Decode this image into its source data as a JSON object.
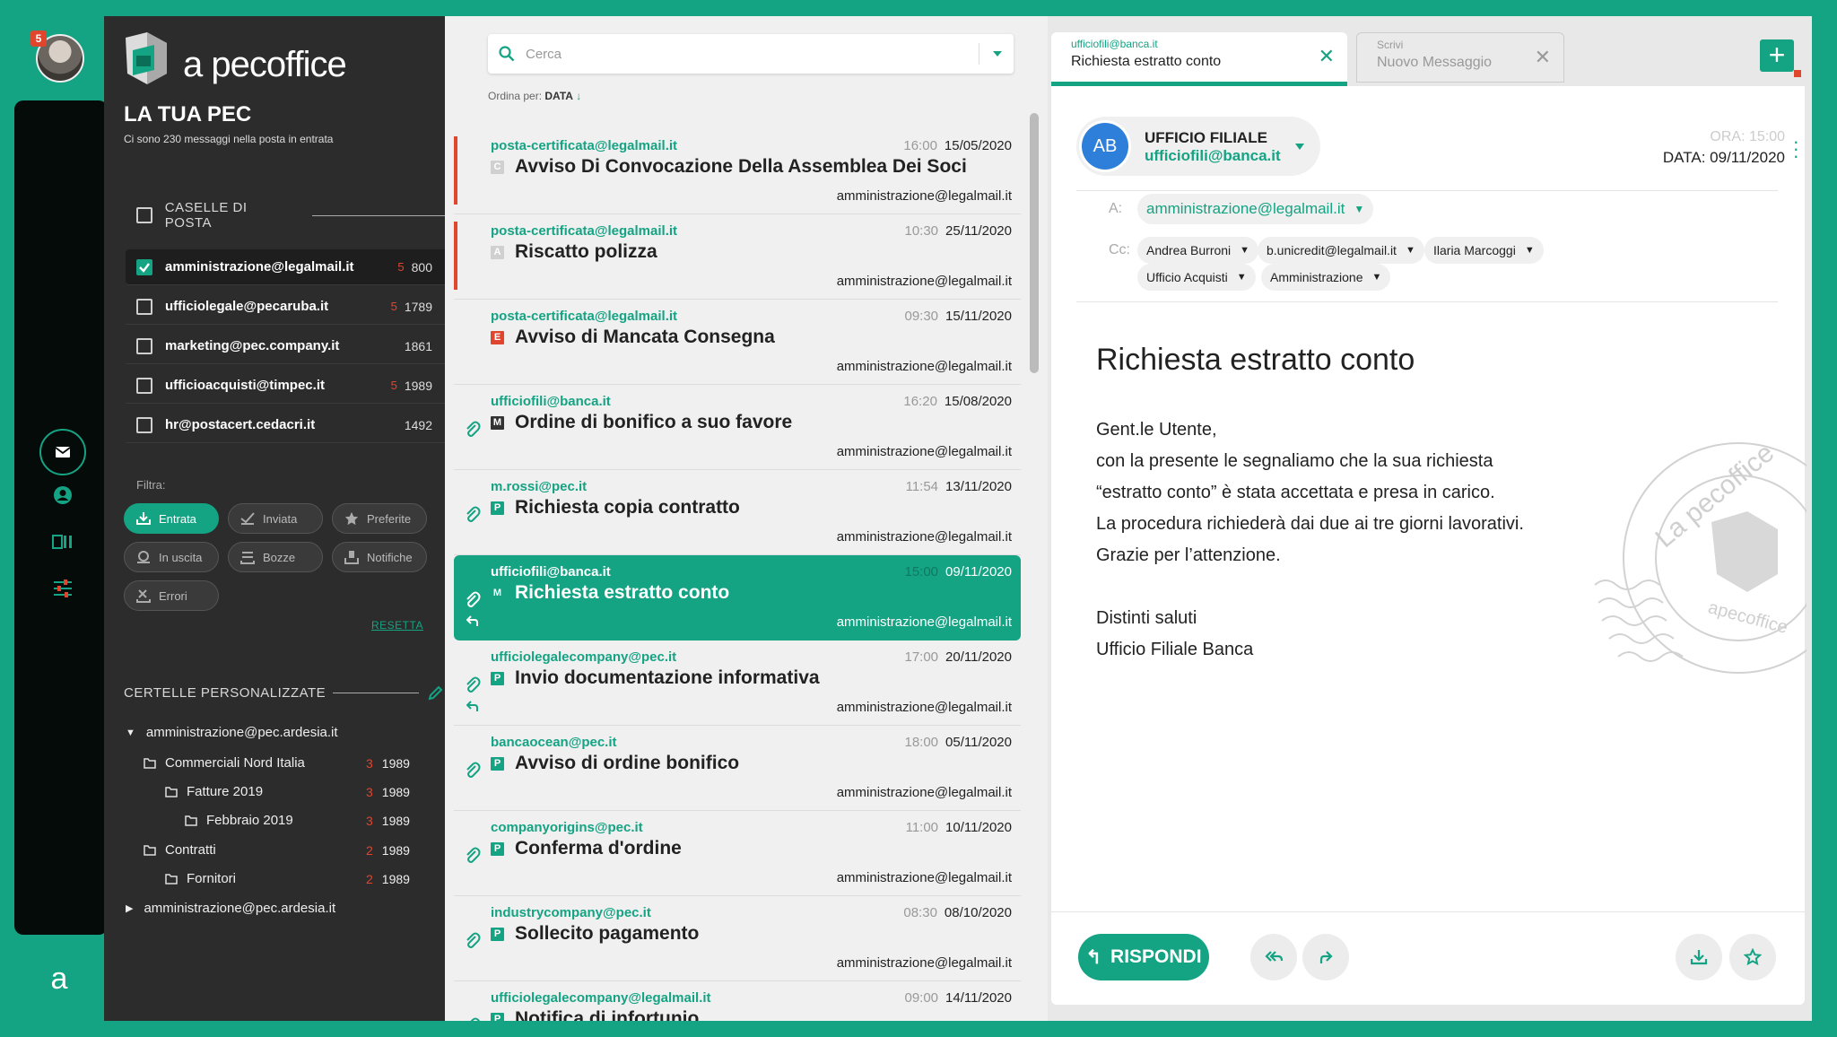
{
  "colors": {
    "brand": "#14a383",
    "alert": "#e0452e",
    "dark": "#2c2c2c"
  },
  "rail": {
    "notification_count": "5",
    "icons": [
      "mail-icon",
      "user-icon",
      "contacts-icon",
      "settings-sliders-icon"
    ],
    "bottom_logo": "a"
  },
  "sidebar": {
    "logo_text": "a pecoffice",
    "title": "LA TUA PEC",
    "subtitle": "Ci sono 230 messaggi nella posta in entrata",
    "mailboxes_header": "CASELLE DI POSTA",
    "mailboxes": [
      {
        "name": "amministrazione@legalmail.it",
        "unread": "5",
        "count": "800",
        "checked": true
      },
      {
        "name": "ufficiolegale@pecaruba.it",
        "unread": "5",
        "count": "1789",
        "checked": false
      },
      {
        "name": "marketing@pec.company.it",
        "unread": "",
        "count": "1861",
        "checked": false
      },
      {
        "name": "ufficioacquisti@timpec.it",
        "unread": "5",
        "count": "1989",
        "checked": false
      },
      {
        "name": "hr@postacert.cedacri.it",
        "unread": "",
        "count": "1492",
        "checked": false
      }
    ],
    "filter_label": "Filtra:",
    "filters": [
      "Entrata",
      "Inviata",
      "Preferite",
      "In uscita",
      "Bozze",
      "Notifiche",
      "Errori"
    ],
    "reset_label": "RESETTA",
    "custom_header": "CERTELLE PERSONALIZZATE",
    "tree": [
      {
        "label": "amministrazione@pec.ardesia.it",
        "unread": "",
        "count": ""
      },
      {
        "label": "Commerciali Nord Italia",
        "unread": "3",
        "count": "1989"
      },
      {
        "label": "Fatture 2019",
        "unread": "3",
        "count": "1989"
      },
      {
        "label": "Febbraio 2019",
        "unread": "3",
        "count": "1989"
      },
      {
        "label": "Contratti",
        "unread": "2",
        "count": "1989"
      },
      {
        "label": "Fornitori",
        "unread": "2",
        "count": "1989"
      },
      {
        "label": "amministrazione@pec.ardesia.it",
        "unread": "",
        "count": ""
      }
    ]
  },
  "list": {
    "search_placeholder": "Cerca",
    "sort_label": "Ordina per:",
    "sort_value": "DATA",
    "messages": [
      {
        "from": "posta-certificata@legalmail.it",
        "time": "16:00",
        "date": "15/05/2020",
        "badge": "C",
        "subject": "Avviso Di Convocazione Della Assemblea Dei Soci",
        "to": "amministrazione@legalmail.it"
      },
      {
        "from": "posta-certificata@legalmail.it",
        "time": "10:30",
        "date": "25/11/2020",
        "badge": "A",
        "subject": "Riscatto polizza",
        "to": "amministrazione@legalmail.it"
      },
      {
        "from": "posta-certificata@legalmail.it",
        "time": "09:30",
        "date": "15/11/2020",
        "badge": "E",
        "subject": "Avviso di Mancata Consegna",
        "to": "amministrazione@legalmail.it"
      },
      {
        "from": "ufficiofili@banca.it",
        "time": "16:20",
        "date": "15/08/2020",
        "badge": "M",
        "subject": "Ordine di bonifico a suo favore",
        "to": "amministrazione@legalmail.it"
      },
      {
        "from": "m.rossi@pec.it",
        "time": "11:54",
        "date": "13/11/2020",
        "badge": "P",
        "subject": "Richiesta copia contratto",
        "to": "amministrazione@legalmail.it"
      },
      {
        "from": "ufficiofili@banca.it",
        "time": "15:00",
        "date": "09/11/2020",
        "badge": "M",
        "subject": "Richiesta estratto conto",
        "to": "amministrazione@legalmail.it"
      },
      {
        "from": "ufficiolegalecompany@pec.it",
        "time": "17:00",
        "date": "20/11/2020",
        "badge": "P",
        "subject": "Invio documentazione informativa",
        "to": "amministrazione@legalmail.it"
      },
      {
        "from": "bancaocean@pec.it",
        "time": "18:00",
        "date": "05/11/2020",
        "badge": "P",
        "subject": "Avviso di ordine bonifico",
        "to": "amministrazione@legalmail.it"
      },
      {
        "from": "companyorigins@pec.it",
        "time": "11:00",
        "date": "10/11/2020",
        "badge": "P",
        "subject": "Conferma d'ordine",
        "to": "amministrazione@legalmail.it"
      },
      {
        "from": "industrycompany@pec.it",
        "time": "08:30",
        "date": "08/10/2020",
        "badge": "P",
        "subject": "Sollecito pagamento",
        "to": "amministrazione@legalmail.it"
      },
      {
        "from": "ufficiolegalecompany@legalmail.it",
        "time": "09:00",
        "date": "14/11/2020",
        "badge": "P",
        "subject": "Notifica di infortunio",
        "to": ""
      }
    ]
  },
  "tabs": [
    {
      "sub": "ufficiofili@banca.it",
      "title": "Richiesta estratto conto",
      "close": "✕"
    },
    {
      "sub": "Scrivi",
      "title": "Nuovo Messaggio",
      "close": "✕"
    }
  ],
  "new_tab": "+",
  "detail": {
    "avatar": "AB",
    "sender_name": "UFFICIO FILIALE",
    "sender_email": "ufficiofili@banca.it",
    "time": "ORA: 15:00",
    "date": "DATA: 09/11/2020",
    "to_label": "A:",
    "to": "amministrazione@legalmail.it",
    "cc_label": "Cc:",
    "cc": [
      "Andrea Burroni",
      "b.unicredit@legalmail.it",
      "Ilaria Marcoggi",
      "Ufficio Acquisti",
      "Amministrazione"
    ],
    "subject": "Richiesta estratto conto",
    "body": [
      "Gent.le Utente,",
      "con la presente le segnaliamo che la sua richiesta",
      "“estratto conto” è stata accettata e presa in carico.",
      "La procedura richiederà dai due ai tre giorni lavorativi.",
      "Grazie per l’attenzione.",
      "",
      "Distinti saluti",
      "Ufficio Filiale Banca"
    ],
    "reply_label": "RISPONDI",
    "stamp_text": "La pecoffice",
    "stamp_text2": "apecoffice"
  }
}
